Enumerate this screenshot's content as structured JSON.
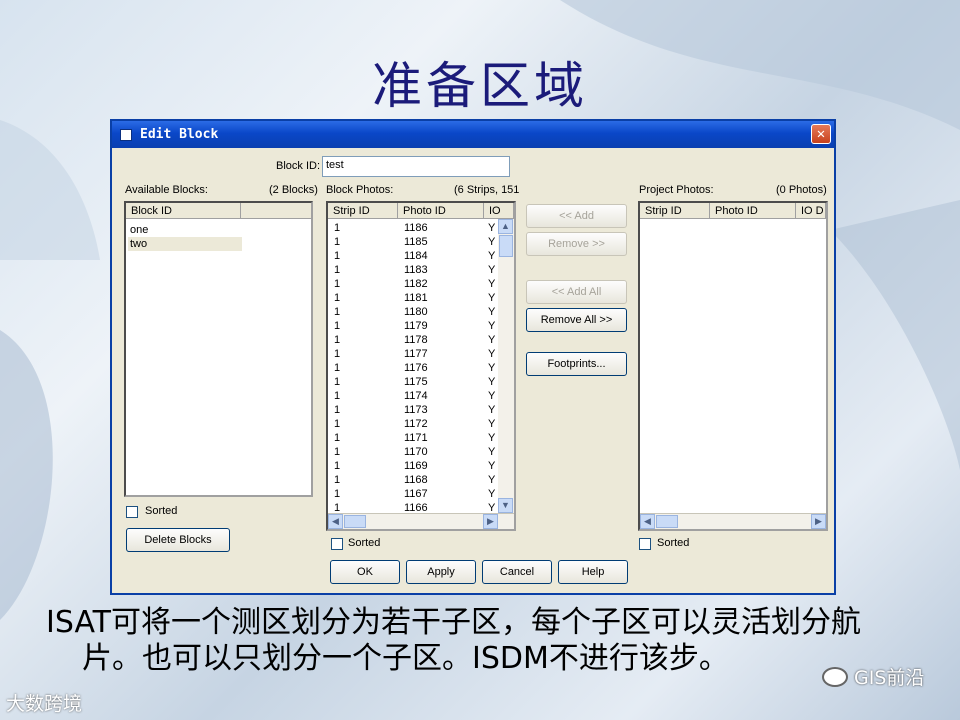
{
  "slide": {
    "title": "准备区域",
    "caption_line1": "ISAT可将一个测区划分为若干子区，每个子区可以灵活划分航",
    "caption_line2": "片。也可以只划分一个子区。ISDM不进行该步。",
    "logo_left": "大数跨境",
    "logo_right": "GIS前沿"
  },
  "dialog": {
    "title": "Edit Block",
    "block_id_label": "Block ID:",
    "block_id_value": "test",
    "available": {
      "label": "Available Blocks:",
      "count": "(2 Blocks)",
      "header": "Block ID",
      "items": [
        "one",
        "two"
      ],
      "sorted_label": "Sorted",
      "delete_label": "Delete  Blocks"
    },
    "block_photos": {
      "label": "Block Photos:",
      "count": "(6 Strips, 151",
      "headers": [
        "Strip ID",
        "Photo ID",
        "IO"
      ],
      "rows": [
        [
          "1",
          "1186",
          "Y"
        ],
        [
          "1",
          "1185",
          "Y"
        ],
        [
          "1",
          "1184",
          "Y"
        ],
        [
          "1",
          "1183",
          "Y"
        ],
        [
          "1",
          "1182",
          "Y"
        ],
        [
          "1",
          "1181",
          "Y"
        ],
        [
          "1",
          "1180",
          "Y"
        ],
        [
          "1",
          "1179",
          "Y"
        ],
        [
          "1",
          "1178",
          "Y"
        ],
        [
          "1",
          "1177",
          "Y"
        ],
        [
          "1",
          "1176",
          "Y"
        ],
        [
          "1",
          "1175",
          "Y"
        ],
        [
          "1",
          "1174",
          "Y"
        ],
        [
          "1",
          "1173",
          "Y"
        ],
        [
          "1",
          "1172",
          "Y"
        ],
        [
          "1",
          "1171",
          "Y"
        ],
        [
          "1",
          "1170",
          "Y"
        ],
        [
          "1",
          "1169",
          "Y"
        ],
        [
          "1",
          "1168",
          "Y"
        ],
        [
          "1",
          "1167",
          "Y"
        ],
        [
          "1",
          "1166",
          "Y"
        ]
      ],
      "sorted_label": "Sorted"
    },
    "buttons_mid": {
      "add": "<< Add",
      "remove": "Remove >>",
      "add_all": "<< Add All",
      "remove_all": "Remove All >>",
      "footprints": "Footprints..."
    },
    "project_photos": {
      "label": "Project Photos:",
      "count": "(0 Photos)",
      "headers": [
        "Strip ID",
        "Photo ID",
        "IO D"
      ],
      "sorted_label": "Sorted"
    },
    "bottom": {
      "ok": "OK",
      "apply": "Apply",
      "cancel": "Cancel",
      "help": "Help"
    }
  }
}
